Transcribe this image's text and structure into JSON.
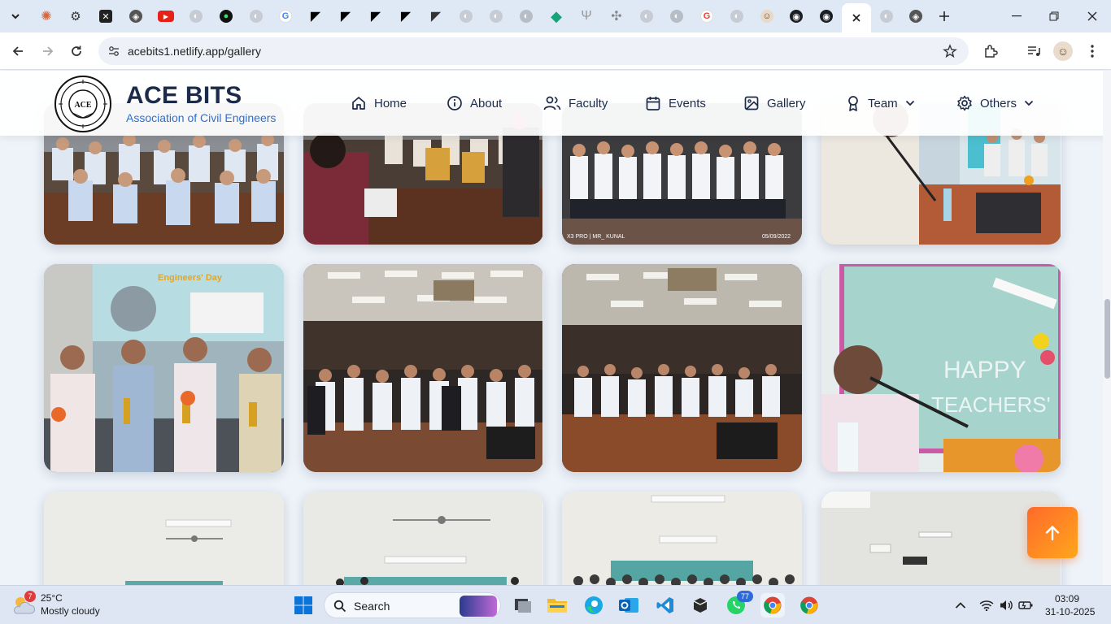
{
  "browser": {
    "url": "acebits1.netlify.app/gallery",
    "tab_count_badge": "77"
  },
  "site": {
    "brand_title": "ACE BITS",
    "brand_subtitle": "Association of Civil Engineers",
    "nav": [
      {
        "label": "Home",
        "icon": "home-icon"
      },
      {
        "label": "About",
        "icon": "info-icon"
      },
      {
        "label": "Faculty",
        "icon": "users-icon"
      },
      {
        "label": "Events",
        "icon": "calendar-icon"
      },
      {
        "label": "Gallery",
        "icon": "image-icon"
      },
      {
        "label": "Team",
        "icon": "award-icon",
        "dropdown": true
      },
      {
        "label": "Others",
        "icon": "gear-icon",
        "dropdown": true
      }
    ],
    "photo_overlay_text": "X3 PRO | MR_ KUNAL",
    "photo_overlay_date": "05/09/2022",
    "photo_banner_text": "Engineers' Day",
    "photo_board_text_1": "HAPPY",
    "photo_board_text_2": "TEACHERS'"
  },
  "taskbar": {
    "weather_temp": "25°C",
    "weather_desc": "Mostly cloudy",
    "weather_badge": "7",
    "search_label": "Search",
    "time": "03:09",
    "date": "31-10-2025"
  },
  "colors": {
    "accent_blue": "#2e6fd1",
    "brand_navy": "#1d2b4a",
    "scroll_button_orange": "#ff7a22"
  }
}
